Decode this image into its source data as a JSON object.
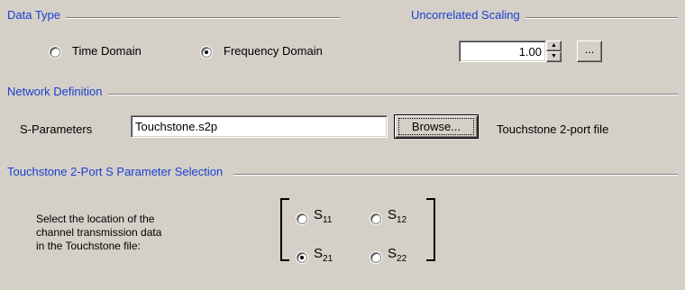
{
  "data_type": {
    "title": "Data Type",
    "options": [
      {
        "label": "Time Domain",
        "selected": false
      },
      {
        "label": "Frequency Domain",
        "selected": true
      }
    ]
  },
  "scaling": {
    "title": "Uncorrelated Scaling",
    "value": "1.00",
    "more_label": "..."
  },
  "network": {
    "title": "Network Definition",
    "s_param_label": "S-Parameters",
    "file_value": "Touchstone.s2p",
    "browse_label": "Browse...",
    "file_desc": "Touchstone 2-port file"
  },
  "selection": {
    "title": "Touchstone 2-Port S Parameter Selection",
    "instruction_line1": "Select the location of the",
    "instruction_line2": "channel transmission data",
    "instruction_line3": "in the Touchstone file:",
    "params": [
      {
        "base": "S",
        "sub": "11",
        "selected": false
      },
      {
        "base": "S",
        "sub": "12",
        "selected": false
      },
      {
        "base": "S",
        "sub": "21",
        "selected": true
      },
      {
        "base": "S",
        "sub": "22",
        "selected": false
      }
    ]
  }
}
